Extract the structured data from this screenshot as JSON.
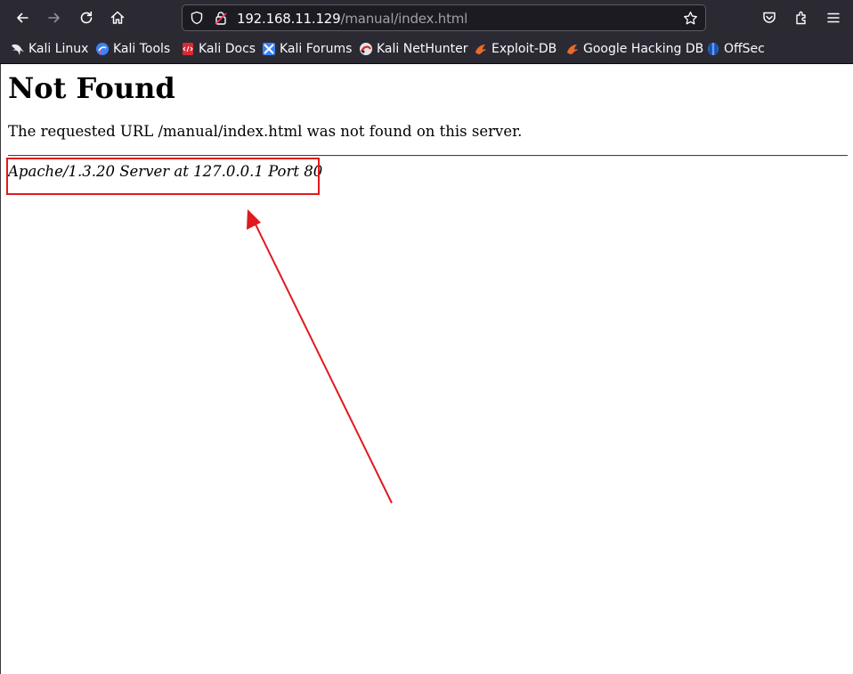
{
  "browser": {
    "url_host": "192.168.11.129",
    "url_path": "/manual/index.html",
    "icons": {
      "back": "arrow-left-icon",
      "forward": "arrow-right-icon",
      "reload": "reload-icon",
      "home": "home-icon",
      "shield": "shield-icon",
      "lock": "insecure-lock-icon",
      "star": "star-icon",
      "pocket": "pocket-icon",
      "extensions": "extensions-icon",
      "menu": "hamburger-menu-icon"
    }
  },
  "bookmarks": [
    {
      "label": "Kali Linux",
      "icon": "kali-dragon-icon"
    },
    {
      "label": "Kali Tools",
      "icon": "kali-tools-icon"
    },
    {
      "label": "Kali Docs",
      "icon": "kali-docs-icon"
    },
    {
      "label": "Kali Forums",
      "icon": "kali-forums-icon"
    },
    {
      "label": "Kali NetHunter",
      "icon": "nethunter-icon"
    },
    {
      "label": "Exploit-DB",
      "icon": "exploit-db-icon"
    },
    {
      "label": "Google Hacking DB",
      "icon": "ghdb-icon"
    },
    {
      "label": "OffSec",
      "icon": "offsec-icon"
    }
  ],
  "page": {
    "heading": "Not Found",
    "message": "The requested URL /manual/index.html was not found on this server.",
    "server_signature": "Apache/1.3.20 Server at 127.0.0.1 Port 80"
  },
  "annotation": {
    "color": "#e0191e"
  }
}
